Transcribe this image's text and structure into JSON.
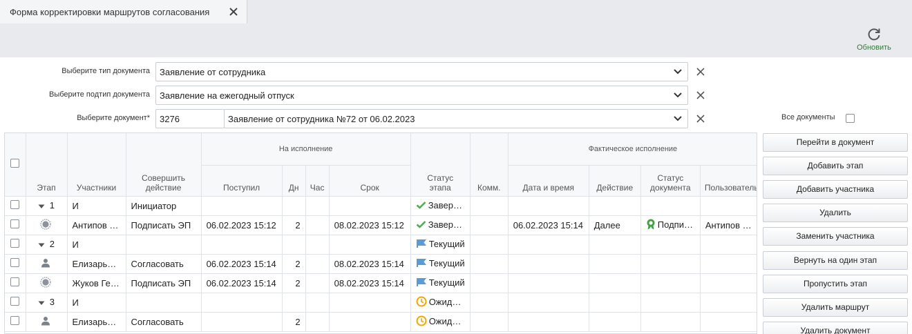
{
  "tab": {
    "title": "Форма корректировки маршрутов согласования"
  },
  "toolbar": {
    "refresh_label": "Обновить"
  },
  "form": {
    "doc_type_label": "Выберите тип документа",
    "doc_type_value": "Заявление от сотрудника",
    "doc_subtype_label": "Выберите подтип документа",
    "doc_subtype_value": "Заявление на ежегодный отпуск",
    "doc_label": "Выберите документ*",
    "doc_number": "3276",
    "doc_value": "Заявление от сотрудника №72 от 06.02.2023",
    "all_docs_label": "Все документы"
  },
  "grid": {
    "headers": {
      "stage": "Этап",
      "participants": "Участники",
      "action_line1": "Совершить",
      "action_line2": "действие",
      "execution_group": "На исполнение",
      "received": "Поступил",
      "days": "Дн",
      "hours": "Час",
      "deadline": "Срок",
      "stage_status_line1": "Статус",
      "stage_status_line2": "этапа",
      "comment": "Комм.",
      "actual_group": "Фактическое исполнение",
      "datetime": "Дата и время",
      "act": "Действие",
      "doc_status_line1": "Статус",
      "doc_status_line2": "документа",
      "user": "Пользователь"
    },
    "rows": [
      {
        "kind": "stage",
        "stage": "1",
        "participant": "И",
        "action": "Инициатор",
        "received": "",
        "days": "",
        "hours": "",
        "deadline": "",
        "status_icon": "check-icon",
        "status": "Завершен",
        "comment": "",
        "datetime": "",
        "act": "",
        "doc_status_icon": "",
        "doc_status": "",
        "user": ""
      },
      {
        "kind": "member",
        "member_icon": "seal-icon",
        "participant": "Антипов Андрей",
        "action": "Подписать ЭП",
        "received": "06.02.2023 15:12",
        "days": "2",
        "hours": "",
        "deadline": "08.02.2023 15:12",
        "status_icon": "check-icon",
        "status": "Завершен",
        "comment": "",
        "datetime": "06.02.2023 15:14",
        "act": "Далее",
        "doc_status_icon": "award-icon",
        "doc_status": "Подписан",
        "user": "Антипов Андрей"
      },
      {
        "kind": "stage",
        "stage": "2",
        "participant": "И",
        "action": "",
        "received": "",
        "days": "",
        "hours": "",
        "deadline": "",
        "status_icon": "flag-icon",
        "status": "Текущий",
        "comment": "",
        "datetime": "",
        "act": "",
        "doc_status_icon": "",
        "doc_status": "",
        "user": ""
      },
      {
        "kind": "member",
        "member_icon": "user-icon",
        "participant": "Елизарьева Ольга",
        "action": "Согласовать",
        "received": "06.02.2023 15:14",
        "days": "2",
        "hours": "",
        "deadline": "08.02.2023 15:14",
        "status_icon": "flag-icon",
        "status": "Текущий",
        "comment": "",
        "datetime": "",
        "act": "",
        "doc_status_icon": "",
        "doc_status": "",
        "user": ""
      },
      {
        "kind": "member",
        "member_icon": "seal-icon",
        "participant": "Жуков Геннадий",
        "action": "Подписать ЭП",
        "received": "06.02.2023 15:14",
        "days": "2",
        "hours": "",
        "deadline": "08.02.2023 15:14",
        "status_icon": "flag-icon",
        "status": "Текущий",
        "comment": "",
        "datetime": "",
        "act": "",
        "doc_status_icon": "",
        "doc_status": "",
        "user": ""
      },
      {
        "kind": "stage",
        "stage": "3",
        "participant": "И",
        "action": "",
        "received": "",
        "days": "",
        "hours": "",
        "deadline": "",
        "status_icon": "clock-icon",
        "status": "Ожидает",
        "comment": "",
        "datetime": "",
        "act": "",
        "doc_status_icon": "",
        "doc_status": "",
        "user": ""
      },
      {
        "kind": "member",
        "member_icon": "user-icon",
        "participant": "Елизарьева Ольга",
        "action": "Согласовать",
        "received": "",
        "days": "2",
        "hours": "",
        "deadline": "",
        "status_icon": "clock-icon",
        "status": "Ожидает",
        "comment": "",
        "datetime": "",
        "act": "",
        "doc_status_icon": "",
        "doc_status": "",
        "user": ""
      }
    ]
  },
  "actions": {
    "goto_doc": "Перейти в документ",
    "add_stage": "Добавить этап",
    "add_participant": "Добавить участника",
    "delete": "Удалить",
    "replace_participant": "Заменить участника",
    "back_one_stage": "Вернуть на один этап",
    "skip_stage": "Пропустить этап",
    "delete_route": "Удалить маршрут",
    "delete_doc": "Удалить документ"
  },
  "colors": {
    "accent_green": "#2e7d32",
    "check_green": "#4caf50",
    "flag_blue": "#5b9bd5",
    "clock_orange": "#f0a500"
  }
}
